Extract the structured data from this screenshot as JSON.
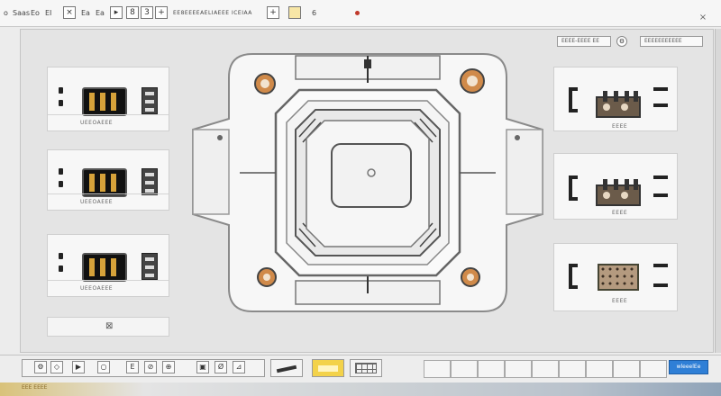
{
  "toolbar": {
    "items": [
      {
        "text": "o",
        "icon": "app-menu-icon"
      },
      {
        "text": "Saas",
        "icon": "none"
      },
      {
        "text": "Eo",
        "icon": "none"
      },
      {
        "text": "EI",
        "icon": "none"
      },
      {
        "text": "Ea",
        "icon": "none"
      },
      {
        "text": "Ea",
        "icon": "none"
      },
      {
        "text": "6",
        "icon": "none"
      }
    ],
    "buttons": [
      {
        "label": "×",
        "name": "close-doc-button"
      },
      {
        "label": "▸",
        "name": "play-button"
      },
      {
        "label": "+",
        "name": "add-button"
      },
      {
        "label": "8",
        "name": "layer-button"
      },
      {
        "label": "3",
        "name": "count-button"
      },
      {
        "label": "+",
        "name": "zoom-in-button"
      }
    ],
    "long_label": "EE8EEEEAELIAEEE ICEIAA",
    "close": "×",
    "accent_dot": "#c0392b"
  },
  "canvas": {
    "header_fields": [
      {
        "text": "EEEE-EEEE EE"
      },
      {
        "text": "EEEEEEEEEEE"
      }
    ]
  },
  "left_modules": [
    {
      "label": "UEEOAEEE"
    },
    {
      "label": "UEEOAEEE"
    },
    {
      "label": "UEEOAEEE"
    }
  ],
  "left_footer_icon": "⊠",
  "right_modules": [
    {
      "label": "EEEE"
    },
    {
      "label": "EEEE"
    },
    {
      "label": "EEEE"
    }
  ],
  "bottom": {
    "icons": [
      "⚙",
      "◇",
      "▶",
      "○",
      "E",
      "⊘",
      "⊕",
      "▣",
      "Ø",
      "⊿"
    ],
    "primary_label": "wleeelEe",
    "status": "EEE EEEE"
  },
  "colors": {
    "accent": "#2f7fd6",
    "copper": "#d08a4a",
    "chip": "#111111",
    "relay": "#6b5b4a"
  }
}
